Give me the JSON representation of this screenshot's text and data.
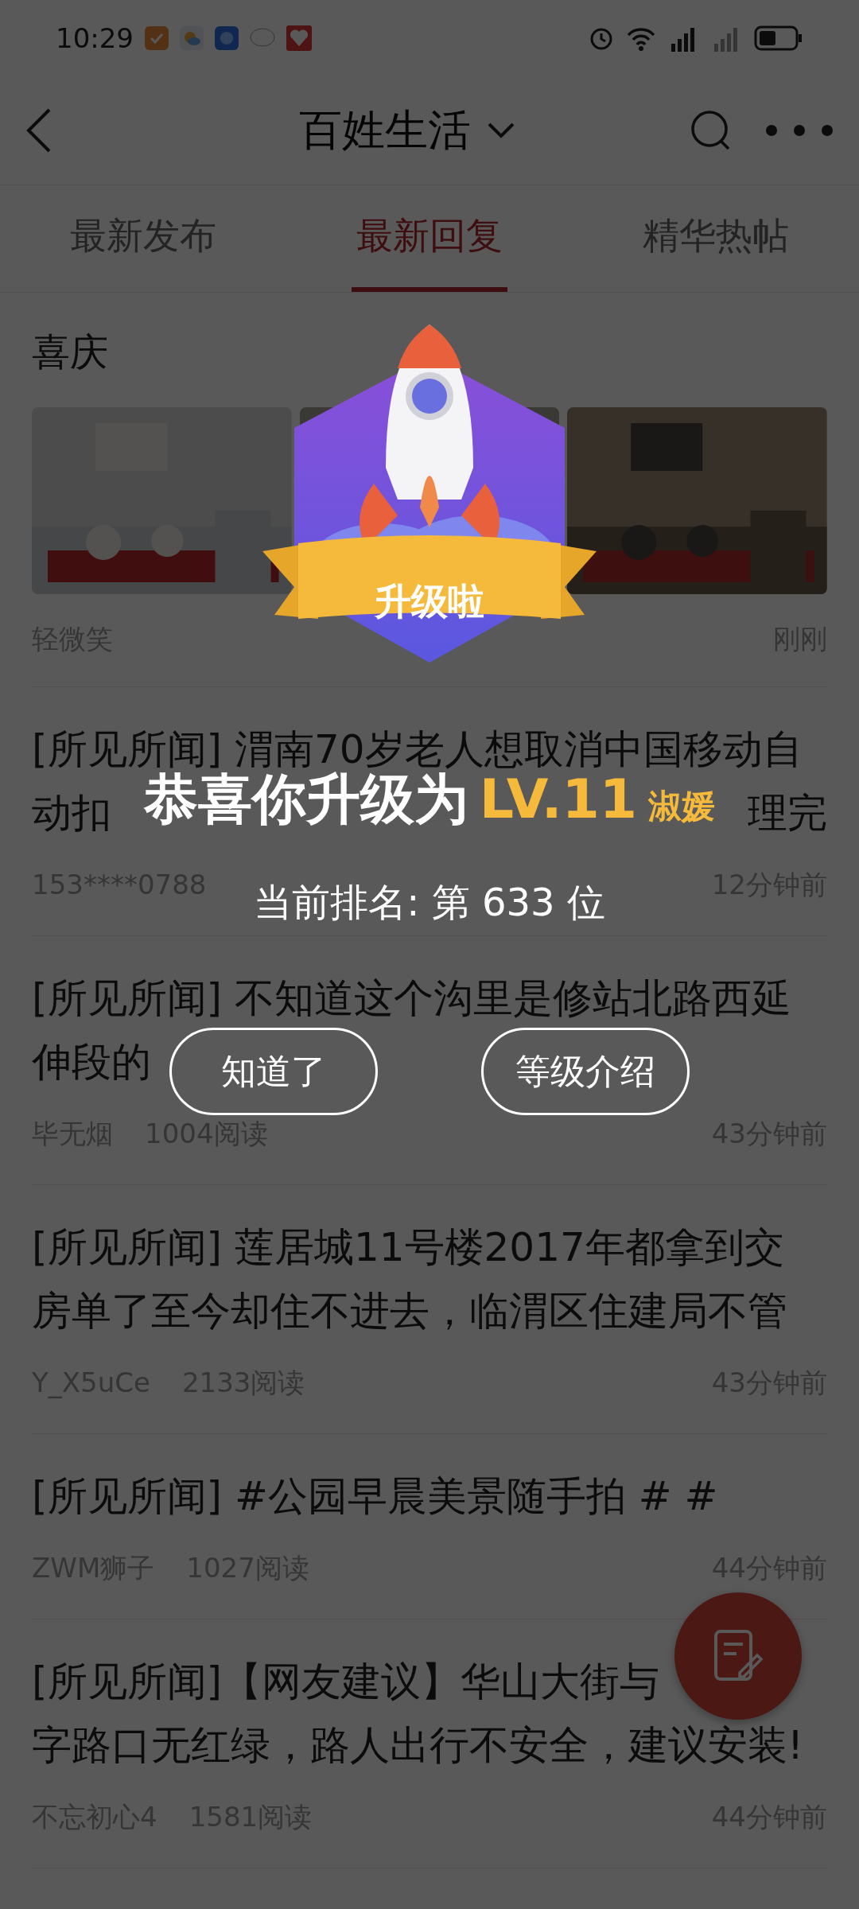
{
  "status_bar": {
    "time": "10:29"
  },
  "header": {
    "title": "百姓生活"
  },
  "tabs": [
    {
      "label": "最新发布",
      "selected": false
    },
    {
      "label": "最新回复",
      "selected": true
    },
    {
      "label": "精华热帖",
      "selected": false
    }
  ],
  "feed": [
    {
      "kind": "gallery",
      "title": "喜庆",
      "author": "轻微笑",
      "time": "刚刚"
    },
    {
      "kind": "post",
      "title_lines": [
        [
          "[所见所闻] 渭南70岁老人想取消中国移动自"
        ],
        [
          "动扣",
          "理完"
        ]
      ],
      "author": "153****0788",
      "time": "12分钟前"
    },
    {
      "kind": "post",
      "title_lines": [
        [
          "[所见所闻] 不知道这个沟里是修站北路西延"
        ],
        [
          "伸段的"
        ]
      ],
      "author": "毕无烟",
      "reads": "1004阅读",
      "time": "43分钟前"
    },
    {
      "kind": "post",
      "title_lines": [
        [
          "[所见所闻] 莲居城11号楼2017年都拿到交"
        ],
        [
          "房单了至今却住不进去，临渭区住建局不管"
        ]
      ],
      "author": "Y_X5uCe",
      "reads": "2133阅读",
      "time": "43分钟前"
    },
    {
      "kind": "post",
      "title_lines": [
        [
          "[所见所闻] #公园早晨美景随手拍 # #"
        ]
      ],
      "author": "ZWM狮子",
      "reads": "1027阅读",
      "time": "44分钟前"
    },
    {
      "kind": "post",
      "title_lines": [
        [
          "[所见所闻]【网友建议】华山大街与"
        ],
        [
          "字路口无红绿，路人出行不安全，建议安装!"
        ]
      ],
      "author": "不忘初心4",
      "reads": "1581阅读",
      "time": "44分钟前"
    }
  ],
  "overlay": {
    "badge": "升级啦",
    "heading": "恭喜你升级为",
    "level": "LV.11",
    "level_title": "淑媛",
    "rank": "当前排名: 第 633 位",
    "buttons": [
      "知道了",
      "等级介绍"
    ]
  }
}
